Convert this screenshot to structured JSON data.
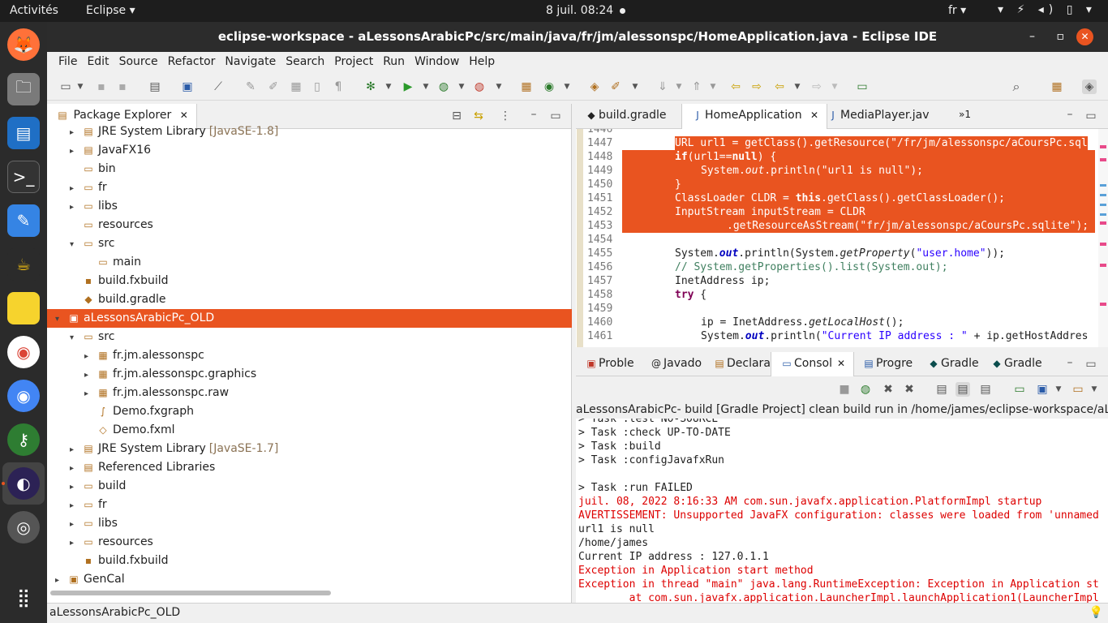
{
  "topbar": {
    "activities": "Activités",
    "app": "Eclipse ▾",
    "clock": "8 juil.  08:24",
    "lang": "fr ▾",
    "tray": "▾ ⚡ ◂) ▯ ▾"
  },
  "window": {
    "title": "eclipse-workspace - aLessonsArabicPc/src/main/java/fr/jm/alessonspc/HomeApplication.java - Eclipse IDE",
    "minimize": "–",
    "maximize": "▫",
    "close": "✕"
  },
  "menu": [
    "File",
    "Edit",
    "Source",
    "Refactor",
    "Navigate",
    "Search",
    "Project",
    "Run",
    "Window",
    "Help"
  ],
  "package_explorer": {
    "tab_label": "Package Explorer",
    "rows": [
      {
        "label": "JRE System Library",
        "decor": "[JavaSE-1.8]",
        "indent": 1,
        "twisty": "▸",
        "icon": "▤"
      },
      {
        "label": "JavaFX16",
        "decor": "",
        "indent": 1,
        "twisty": "▸",
        "icon": "▤"
      },
      {
        "label": "bin",
        "decor": "",
        "indent": 1,
        "twisty": "",
        "icon": "▭"
      },
      {
        "label": "fr",
        "decor": "",
        "indent": 1,
        "twisty": "▸",
        "icon": "▭"
      },
      {
        "label": "libs",
        "decor": "",
        "indent": 1,
        "twisty": "▸",
        "icon": "▭"
      },
      {
        "label": "resources",
        "decor": "",
        "indent": 1,
        "twisty": "",
        "icon": "▭"
      },
      {
        "label": "src",
        "decor": "",
        "indent": 1,
        "twisty": "▾",
        "icon": "▭"
      },
      {
        "label": "main",
        "decor": "",
        "indent": 2,
        "twisty": "",
        "icon": "▭"
      },
      {
        "label": "build.fxbuild",
        "decor": "",
        "indent": 1,
        "twisty": "",
        "icon": "▪"
      },
      {
        "label": "build.gradle",
        "decor": "",
        "indent": 1,
        "twisty": "",
        "icon": "◆"
      },
      {
        "label": "aLessonsArabicPc_OLD",
        "decor": "",
        "indent": 0,
        "twisty": "▾",
        "icon": "▣",
        "selected": true
      },
      {
        "label": "src",
        "decor": "",
        "indent": 1,
        "twisty": "▾",
        "icon": "▭"
      },
      {
        "label": "fr.jm.alessonspc",
        "decor": "",
        "indent": 2,
        "twisty": "▸",
        "icon": "▦"
      },
      {
        "label": "fr.jm.alessonspc.graphics",
        "decor": "",
        "indent": 2,
        "twisty": "▸",
        "icon": "▦"
      },
      {
        "label": "fr.jm.alessonspc.raw",
        "decor": "",
        "indent": 2,
        "twisty": "▸",
        "icon": "▦"
      },
      {
        "label": "Demo.fxgraph",
        "decor": "",
        "indent": 2,
        "twisty": "",
        "icon": "∫"
      },
      {
        "label": "Demo.fxml",
        "decor": "",
        "indent": 2,
        "twisty": "",
        "icon": "◇"
      },
      {
        "label": "JRE System Library",
        "decor": "[JavaSE-1.7]",
        "indent": 1,
        "twisty": "▸",
        "icon": "▤"
      },
      {
        "label": "Referenced Libraries",
        "decor": "",
        "indent": 1,
        "twisty": "▸",
        "icon": "▤"
      },
      {
        "label": "build",
        "decor": "",
        "indent": 1,
        "twisty": "▸",
        "icon": "▭"
      },
      {
        "label": "fr",
        "decor": "",
        "indent": 1,
        "twisty": "▸",
        "icon": "▭"
      },
      {
        "label": "libs",
        "decor": "",
        "indent": 1,
        "twisty": "▸",
        "icon": "▭"
      },
      {
        "label": "resources",
        "decor": "",
        "indent": 1,
        "twisty": "▸",
        "icon": "▭"
      },
      {
        "label": "build.fxbuild",
        "decor": "",
        "indent": 1,
        "twisty": "",
        "icon": "▪"
      },
      {
        "label": "GenCal",
        "decor": "",
        "indent": 0,
        "twisty": "▸",
        "icon": "▣"
      }
    ]
  },
  "editor": {
    "tabs": [
      {
        "label": "build.gradle",
        "active": false
      },
      {
        "label": "HomeApplication",
        "active": true
      },
      {
        "label": "MediaPlayer.jav",
        "active": false
      }
    ],
    "overflow": "»1",
    "lines": [
      {
        "n": "1446",
        "html": "",
        "hl": false
      },
      {
        "n": "1447",
        "text": "URL url1 = getClass().getResource(\"/fr/jm/alessonspc/aCoursPc.sql",
        "hl": true
      },
      {
        "n": "1448",
        "text": "if(url1==null) {",
        "hl": true
      },
      {
        "n": "1449",
        "text": "    System.out.println(\"url1 is null\");",
        "hl": true
      },
      {
        "n": "1450",
        "text": "}",
        "hl": true
      },
      {
        "n": "1451",
        "text": "ClassLoader CLDR = this.getClass().getClassLoader();",
        "hl": true
      },
      {
        "n": "1452",
        "text": "InputStream inputStream = CLDR",
        "hl": true
      },
      {
        "n": "1453",
        "text": "        .getResourceAsStream(\"fr/jm/alessonspc/aCoursPc.sqlite\");",
        "hl": true
      },
      {
        "n": "1454",
        "text": "",
        "hl": false
      },
      {
        "n": "1455",
        "text": "System.out.println(System.getProperty(\"user.home\"));",
        "hl": false
      },
      {
        "n": "1456",
        "text": "// System.getProperties().list(System.out);",
        "hl": false
      },
      {
        "n": "1457",
        "text": "InetAddress ip;",
        "hl": false
      },
      {
        "n": "1458",
        "text": "try {",
        "hl": false
      },
      {
        "n": "1459",
        "text": "",
        "hl": false
      },
      {
        "n": "1460",
        "text": "    ip = InetAddress.getLocalHost();",
        "hl": false
      },
      {
        "n": "1461",
        "text": "    System.out.println(\"Current IP address : \" + ip.getHostAddres",
        "hl": false
      }
    ]
  },
  "bottom_tabs": [
    {
      "label": "Proble",
      "active": false
    },
    {
      "label": "Javado",
      "active": false
    },
    {
      "label": "Declara",
      "active": false
    },
    {
      "label": "Consol",
      "active": true
    },
    {
      "label": "Progre",
      "active": false
    },
    {
      "label": "Gradle",
      "active": false
    },
    {
      "label": "Gradle",
      "active": false
    }
  ],
  "console": {
    "header": "aLessonsArabicPc- build [Gradle Project] clean build run in /home/james/eclipse-workspace/aLesso",
    "lines": [
      {
        "text": "> Task :test NO-SOURCE",
        "err": false
      },
      {
        "text": "> Task :check UP-TO-DATE",
        "err": false
      },
      {
        "text": "> Task :build",
        "err": false
      },
      {
        "text": "> Task :configJavafxRun",
        "err": false
      },
      {
        "text": "",
        "err": false
      },
      {
        "text": "> Task :run FAILED",
        "err": false
      },
      {
        "text": "juil. 08, 2022 8:16:33 AM com.sun.javafx.application.PlatformImpl startup",
        "err": true
      },
      {
        "text": "AVERTISSEMENT: Unsupported JavaFX configuration: classes were loaded from 'unnamed",
        "err": true
      },
      {
        "text": "url1 is null",
        "err": false
      },
      {
        "text": "/home/james",
        "err": false
      },
      {
        "text": "Current IP address : 127.0.1.1",
        "err": false
      },
      {
        "text": "Exception in Application start method",
        "err": true
      },
      {
        "text": "Exception in thread \"main\" java.lang.RuntimeException: Exception in Application st",
        "err": true
      },
      {
        "text": "        at com.sun.javafx.application.LauncherImpl.launchApplication1(LauncherImpl",
        "err": true
      }
    ]
  },
  "status": {
    "text": "aLessonsArabicPc_OLD"
  },
  "colors": {
    "accent": "#e95420",
    "error": "#dd0000"
  }
}
